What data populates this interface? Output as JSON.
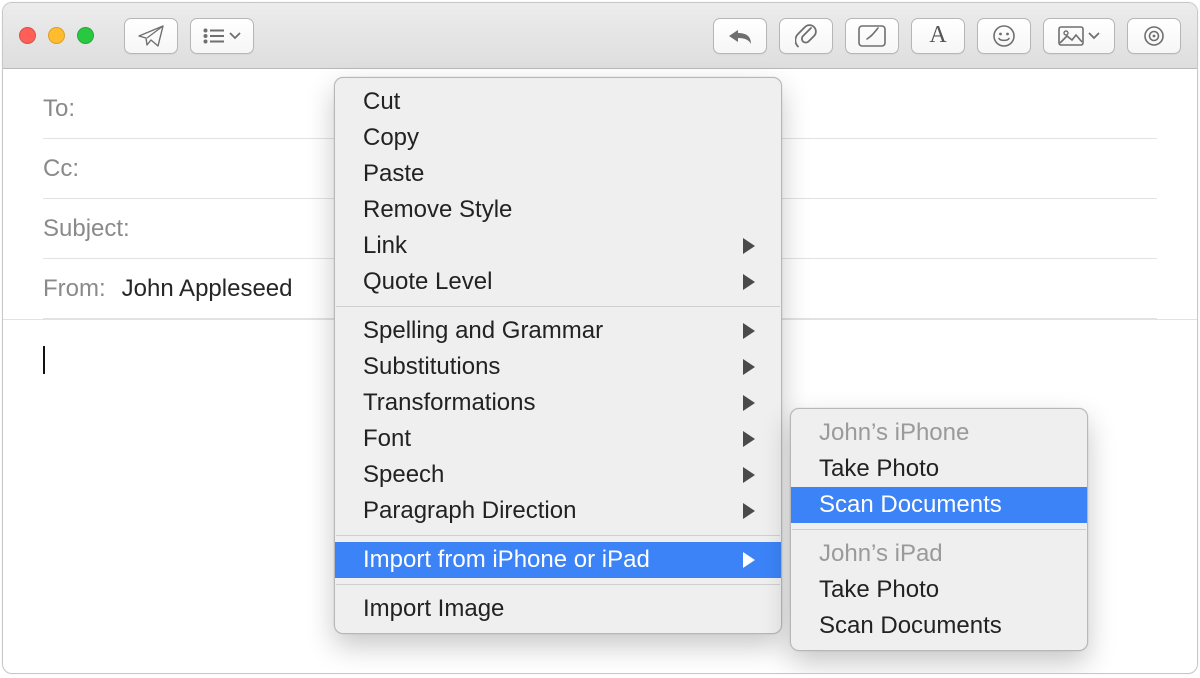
{
  "fields": {
    "to_label": "To:",
    "cc_label": "Cc:",
    "subject_label": "Subject:",
    "from_label": "From:",
    "from_value": "John Appleseed"
  },
  "context_menu": {
    "group1": {
      "cut": "Cut",
      "copy": "Copy",
      "paste": "Paste",
      "remove_style": "Remove Style",
      "link": "Link",
      "quote_level": "Quote Level"
    },
    "group2": {
      "spelling": "Spelling and Grammar",
      "substitutions": "Substitutions",
      "transformations": "Transformations",
      "font": "Font",
      "speech": "Speech",
      "paragraph_direction": "Paragraph Direction"
    },
    "group3": {
      "import_device": "Import from iPhone or iPad"
    },
    "group4": {
      "import_image": "Import Image"
    }
  },
  "submenu": {
    "iphone": {
      "header": "John’s iPhone",
      "take_photo": "Take Photo",
      "scan_documents": "Scan Documents"
    },
    "ipad": {
      "header": "John’s iPad",
      "take_photo": "Take Photo",
      "scan_documents": "Scan Documents"
    }
  }
}
